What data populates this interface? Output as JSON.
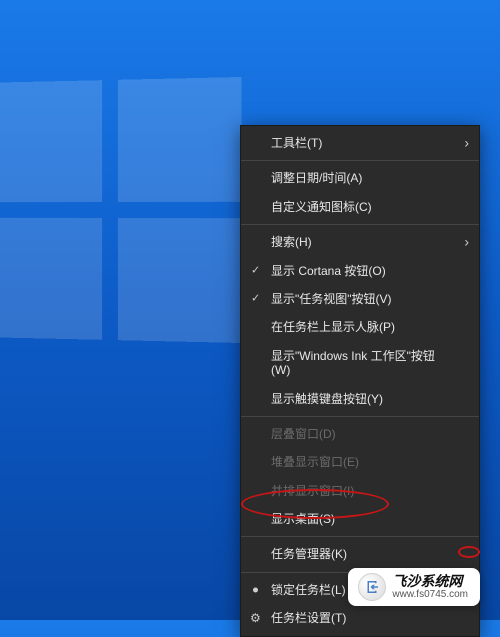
{
  "menu": {
    "toolbars": "工具栏(T)",
    "adjust_datetime": "调整日期/时间(A)",
    "customize_notification_icons": "自定义通知图标(C)",
    "search": "搜索(H)",
    "show_cortana": "显示 Cortana 按钮(O)",
    "show_task_view": "显示\"任务视图\"按钮(V)",
    "show_people": "在任务栏上显示人脉(P)",
    "show_windows_ink": "显示\"Windows Ink 工作区\"按钮(W)",
    "show_touch_keyboard": "显示触摸键盘按钮(Y)",
    "cascade_windows": "层叠窗口(D)",
    "stacked_windows": "堆叠显示窗口(E)",
    "side_by_side": "并排显示窗口(I)",
    "show_desktop": "显示桌面(S)",
    "task_manager": "任务管理器(K)",
    "lock_taskbar": "锁定任务栏(L)",
    "taskbar_settings": "任务栏设置(T)"
  },
  "attribution": {
    "title": "飞沙系统网",
    "url": "www.fs0745.com"
  }
}
